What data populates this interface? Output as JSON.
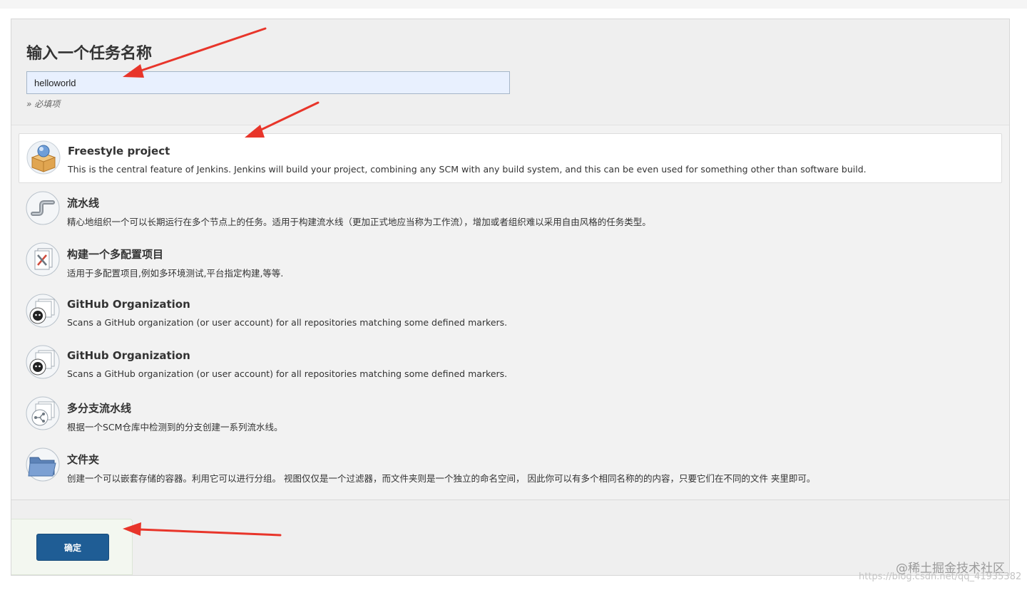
{
  "header": {
    "title": "输入一个任务名称",
    "name_value": "helloworld",
    "required_note": "» 必填项"
  },
  "items": [
    {
      "title": "Freestyle project",
      "description": "This is the central feature of Jenkins. Jenkins will build your project, combining any SCM with any build system, and this can be even used for something other than software build.",
      "icon": "freestyle-box-icon"
    },
    {
      "title": "流水线",
      "description": "精心地组织一个可以长期运行在多个节点上的任务。适用于构建流水线（更加正式地应当称为工作流），增加或者组织难以采用自由风格的任务类型。",
      "icon": "pipeline-icon"
    },
    {
      "title": "构建一个多配置项目",
      "description": "适用于多配置项目,例如多环境测试,平台指定构建,等等.",
      "icon": "multi-config-icon"
    },
    {
      "title": "GitHub Organization",
      "description": "Scans a GitHub organization (or user account) for all repositories matching some defined markers.",
      "icon": "github-organization-icon"
    },
    {
      "title": "GitHub Organization",
      "description": "Scans a GitHub organization (or user account) for all repositories matching some defined markers.",
      "icon": "github-organization-icon"
    },
    {
      "title": "多分支流水线",
      "description": "根据一个SCM仓库中检测到的分支创建一系列流水线。",
      "icon": "multibranch-icon"
    },
    {
      "title": "文件夹",
      "description": "创建一个可以嵌套存储的容器。利用它可以进行分组。 视图仅仅是一个过滤器，而文件夹则是一个独立的命名空间， 因此你可以有多个相同名称的的内容，只要它们在不同的文件 夹里即可。",
      "icon": "folder-icon"
    }
  ],
  "footer": {
    "ok_label": "确定"
  },
  "watermark": {
    "text": "@稀土掘金技术社区",
    "url_fragment": "https://blog.csdn.net/qq_41935382"
  },
  "colors": {
    "ok_button": "#1f5d95",
    "annotation_arrow": "#e8352a",
    "input_background": "#e8f0fe"
  }
}
